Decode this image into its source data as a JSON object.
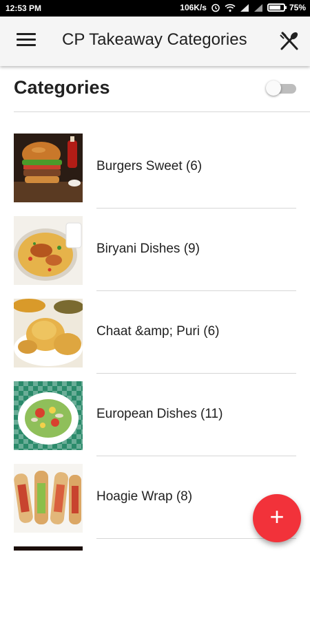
{
  "status_bar": {
    "time": "12:53 PM",
    "network_speed": "106K/s",
    "battery": "75%",
    "battery_level_fraction": 0.75,
    "icons": [
      "alarm-icon",
      "wifi-icon",
      "signal-icon",
      "signal-icon",
      "battery-icon"
    ]
  },
  "app_bar": {
    "title": "CP Takeaway Categories",
    "menu_icon": "menu-icon",
    "action_icon": "cutlery-icon"
  },
  "header": {
    "title": "Categories",
    "toggle_on": false
  },
  "categories": [
    {
      "label": "Burgers Sweet (6)",
      "image": "burger-image"
    },
    {
      "label": "Biryani Dishes (9)",
      "image": "biryani-image"
    },
    {
      "label": "Chaat &amp; Puri (6)",
      "image": "chaat-puri-image"
    },
    {
      "label": "European Dishes (11)",
      "image": "salad-image"
    },
    {
      "label": "Hoagie Wrap (8)",
      "image": "hoagie-image"
    }
  ],
  "fab": {
    "label": "+",
    "icon": "plus-icon",
    "color": "#f2323a"
  }
}
